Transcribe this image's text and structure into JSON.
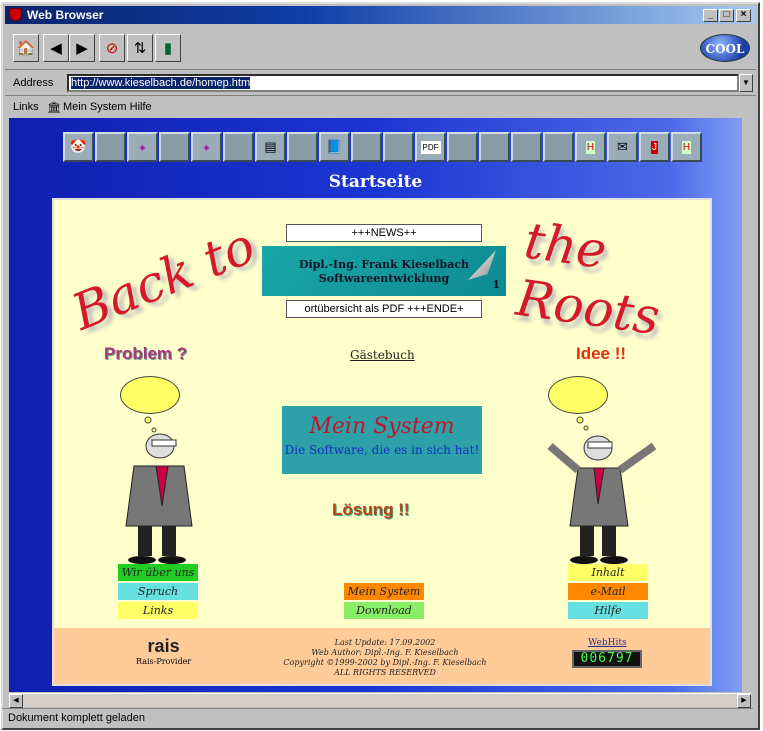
{
  "window": {
    "title": "Web Browser",
    "brand": "COOL"
  },
  "address": {
    "label": "Address",
    "url": "http://www.kieselbach.de/homep.htm"
  },
  "links": {
    "label": "Links",
    "item": "Mein System Hilfe"
  },
  "page": {
    "heading": "Startseite",
    "news": "+++NEWS++",
    "company_line1": "Dipl.-Ing. Frank Kieselbach",
    "company_line2": "Softwareentwicklung",
    "badge_number": "1",
    "ticker": "ortübersicht als PDF +++ENDE+",
    "back_to": "Back to",
    "the_roots": "the Roots",
    "problem": "Problem ?",
    "idee": "Idee !!",
    "gaestebuch": "Gästebuch",
    "mein_system_title": "Mein System",
    "mein_system_sub": "Die Software, die es in sich hat!",
    "loesung": "Lösung !!",
    "left_buttons": [
      "Wir über uns",
      "Spruch",
      "Links"
    ],
    "center_buttons": [
      "Mein System",
      "Download"
    ],
    "right_buttons": [
      "Inhalt",
      "e-Mail",
      "Hilfe"
    ],
    "footer_lines": [
      "Last Update: 17.09.2002",
      "Web Author: Dipl.-Ing. F. Kieselbach",
      "Copyright ©1999-2002 by Dipl.-Ing. F. Kieselbach",
      "ALL RIGHTS RESERVED"
    ],
    "rais_logo": "rais",
    "rais_label": "Rais-Provider",
    "webhits": "WebHits",
    "counter": "006797"
  },
  "status": "Dokument komplett geladen"
}
